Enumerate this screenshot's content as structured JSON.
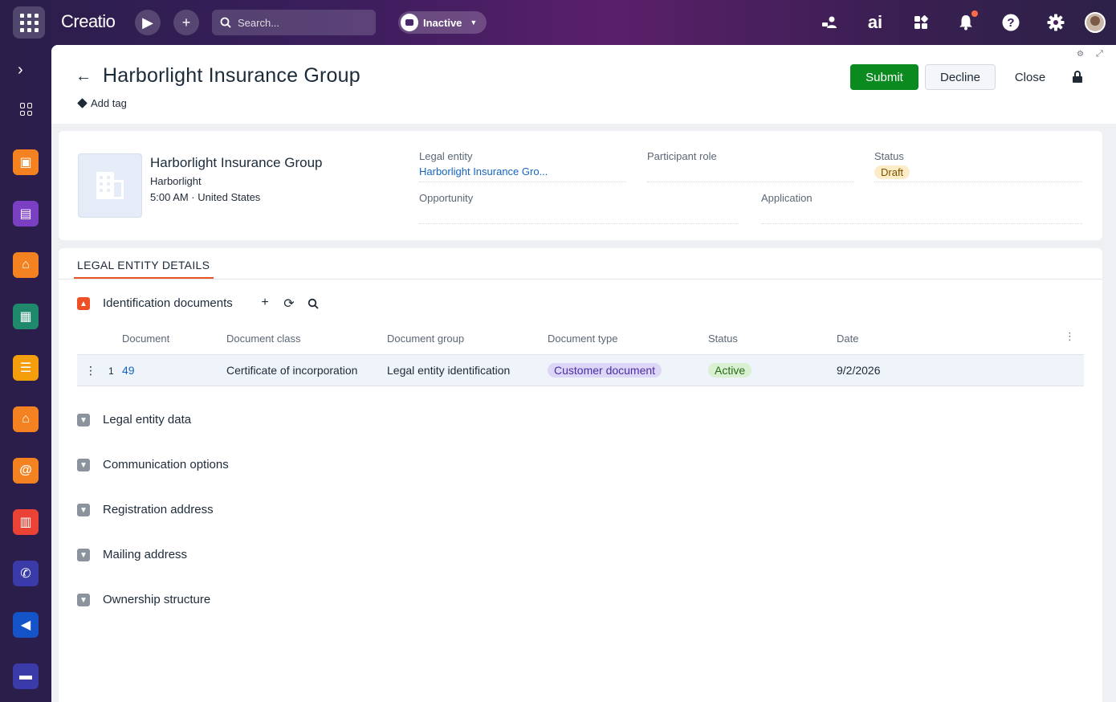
{
  "topbar": {
    "logo": "Creatio",
    "search_placeholder": "Search...",
    "status": "Inactive"
  },
  "colors": {
    "accent_orange": "#ef4f24",
    "submit_green": "#0a8a1f",
    "link_blue": "#1565c0"
  },
  "sidebar": {
    "apps": [
      {
        "icon": "presentation-icon",
        "color": "#f58220"
      },
      {
        "icon": "shop-icon",
        "color": "#7b3fc4"
      },
      {
        "icon": "home-icon",
        "color": "#f58220"
      },
      {
        "icon": "document-list-icon",
        "color": "#1e8a6b"
      },
      {
        "icon": "contact-card-icon",
        "color": "#f59e0b"
      },
      {
        "icon": "home-icon",
        "color": "#f58220"
      },
      {
        "icon": "at-sign-icon",
        "color": "#f58220"
      },
      {
        "icon": "calendar-icon",
        "color": "#ea4335"
      },
      {
        "icon": "phone-icon",
        "color": "#3a3aa8"
      },
      {
        "icon": "megaphone-icon",
        "color": "#1554c8"
      },
      {
        "icon": "cash-register-icon",
        "color": "#3a3aa8"
      }
    ]
  },
  "header": {
    "title": "Harborlight Insurance Group",
    "add_tag": "Add tag",
    "submit": "Submit",
    "decline": "Decline",
    "close": "Close"
  },
  "summary": {
    "name": "Harborlight Insurance Group",
    "short_name": "Harborlight",
    "time_location": "5:00 AM · United States",
    "legal_entity_label": "Legal entity",
    "legal_entity_value": "Harborlight Insurance Gro...",
    "participant_role_label": "Participant role",
    "participant_role_value": "",
    "status_label": "Status",
    "status_value": "Draft",
    "opportunity_label": "Opportunity",
    "opportunity_value": "",
    "application_label": "Application",
    "application_value": ""
  },
  "details": {
    "tab": "LEGAL ENTITY DETAILS",
    "identification": {
      "title": "Identification documents",
      "columns": [
        "Document",
        "Document class",
        "Document group",
        "Document type",
        "Status",
        "Date"
      ],
      "rows": [
        {
          "index": "1",
          "document": "49",
          "document_class": "Certificate of incorporation",
          "document_group": "Legal entity identification",
          "document_type": "Customer document",
          "status": "Active",
          "date": "9/2/2026"
        }
      ]
    },
    "sections": [
      "Legal entity data",
      "Communication options",
      "Registration address",
      "Mailing address",
      "Ownership structure"
    ]
  }
}
